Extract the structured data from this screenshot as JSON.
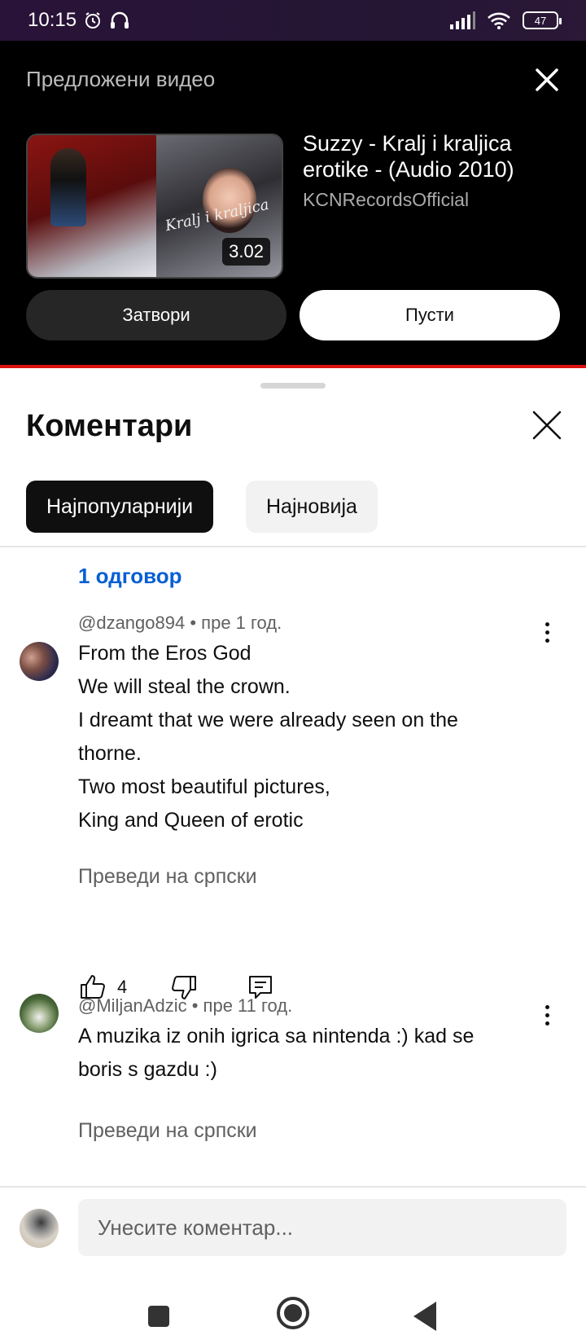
{
  "status_bar": {
    "time": "10:15",
    "battery": "47"
  },
  "suggested": {
    "header": "Предложени видео",
    "video_title": "Suzzy - Kralj i kraljica erotike - (Audio 2010)",
    "channel": "KCNRecordsOfficial",
    "duration": "3.02",
    "close_label": "Затвори",
    "play_label": "Пусти"
  },
  "comments": {
    "title": "Коментари",
    "sort_tabs": [
      {
        "label": "Најпопуларнији",
        "active": true
      },
      {
        "label": "Најновија",
        "active": false
      }
    ],
    "replies_link": "1 одговор",
    "items": [
      {
        "author": "@dzango894",
        "time": "пре 1 год.",
        "lines": [
          "From the Eros God",
          "We will steal the crown.",
          "I dreamt that we were already seen on the",
          "thorne.",
          "Two most beautiful pictures,",
          "King and Queen of erotic"
        ],
        "translate": "Преведи на српски",
        "likes": "4"
      },
      {
        "author": "@MiljanAdzic",
        "time": "пре 11 год.",
        "lines": [
          "A muzika iz onih igrica sa nintenda :) kad se",
          "boris s gazdu :)"
        ],
        "translate": "Преведи на српски"
      }
    ],
    "input_placeholder": "Унесите коментар..."
  },
  "colors": {
    "link_blue": "#065fd4",
    "accent_red": "#dd1111"
  }
}
